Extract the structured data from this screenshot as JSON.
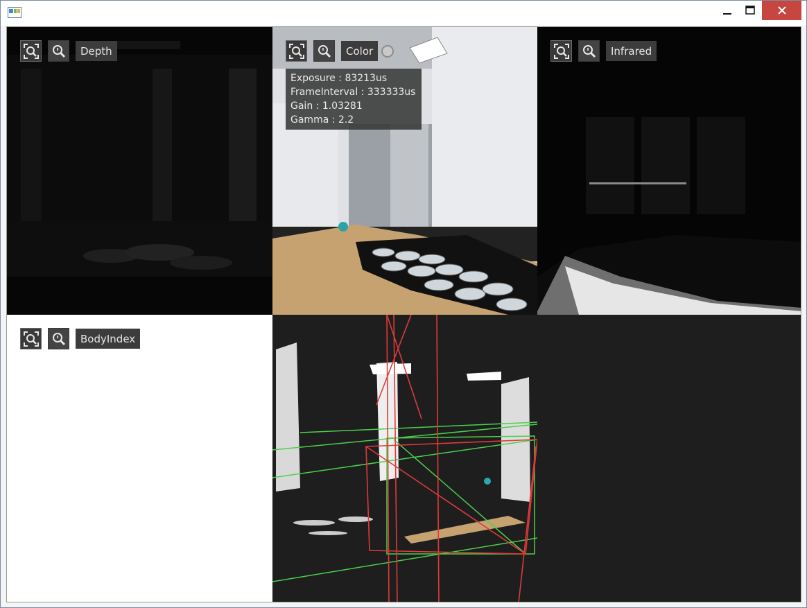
{
  "window": {
    "title": "",
    "controls": {
      "minimize": "minimize",
      "maximize": "maximize",
      "close": "close"
    }
  },
  "panes": {
    "depth": {
      "label": "Depth"
    },
    "color": {
      "label": "Color",
      "info": [
        {
          "key": "Exposure",
          "value": "83213us"
        },
        {
          "key": "FrameInterval",
          "value": "333333us"
        },
        {
          "key": "Gain",
          "value": "1.03281"
        },
        {
          "key": "Gamma",
          "value": "2.2"
        }
      ]
    },
    "infrared": {
      "label": "Infrared"
    },
    "bodyindex": {
      "label": "BodyIndex"
    }
  },
  "colors": {
    "titlebar": "#ffffff",
    "close_button": "#c7463f",
    "chip_bg": "#3c3c3c",
    "chip_text": "#e6e6e6",
    "pointcloud_bg": "#1e1e1e",
    "frustum_red": "#e03a3a",
    "grid_green": "#4cd04c"
  },
  "icons": {
    "fit": "fit-view-icon",
    "zoom": "zoom-icon"
  }
}
